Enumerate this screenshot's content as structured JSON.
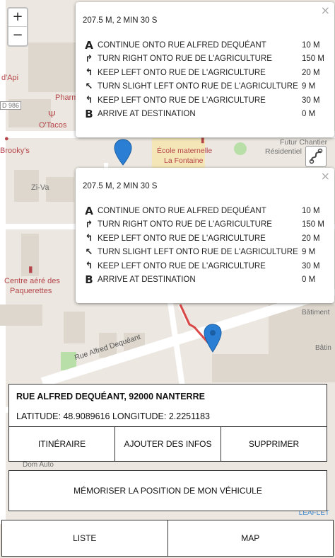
{
  "map": {
    "zoom_in": "+",
    "zoom_out": "−",
    "labels": {
      "dapi": "d'Api",
      "d986": "D 986",
      "pharm": "Pharm",
      "otacos": "O'Tacos",
      "brooky": "Brooky's",
      "ziva": "Zi-Va",
      "ecole1": "École maternelle",
      "ecole2": "La Fontaine",
      "futur1": "Futur Chantier",
      "futur2": "Résidentiel",
      "centre1": "Centre aéré des",
      "centre2": "Paquerettes",
      "batiment1": "Bâtiment",
      "batiment2": "Bâtin",
      "street": "Rue Alfred Dequéant",
      "dom_auto": "Dom Auto"
    },
    "attribution": "LEAFLET"
  },
  "route_panels": [
    {
      "summary": "207.5 M, 2 MIN 30 S",
      "close": "×",
      "instructions": [
        {
          "icon": "A",
          "text": "CONTINUE ONTO RUE ALFRED DEQUÉANT",
          "dist": "10 M"
        },
        {
          "icon": "↱",
          "text": "TURN RIGHT ONTO RUE DE L'AGRICULTURE",
          "dist": "150 M"
        },
        {
          "icon": "↰",
          "text": "KEEP LEFT ONTO RUE DE L'AGRICULTURE",
          "dist": "20 M"
        },
        {
          "icon": "↖",
          "text": "TURN SLIGHT LEFT ONTO RUE DE L'AGRICULTURE",
          "dist": "9 M"
        },
        {
          "icon": "↰",
          "text": "KEEP LEFT ONTO RUE DE L'AGRICULTURE",
          "dist": "30 M"
        },
        {
          "icon": "B",
          "text": "ARRIVE AT DESTINATION",
          "dist": "0 M"
        }
      ]
    },
    {
      "summary": "207.5 M, 2 MIN 30 S",
      "close": "×",
      "instructions": [
        {
          "icon": "A",
          "text": "CONTINUE ONTO RUE ALFRED DEQUÉANT",
          "dist": "10 M"
        },
        {
          "icon": "↱",
          "text": "TURN RIGHT ONTO RUE DE L'AGRICULTURE",
          "dist": "150 M"
        },
        {
          "icon": "↰",
          "text": "KEEP LEFT ONTO RUE DE L'AGRICULTURE",
          "dist": "20 M"
        },
        {
          "icon": "↖",
          "text": "TURN SLIGHT LEFT ONTO RUE DE L'AGRICULTURE",
          "dist": "9 M"
        },
        {
          "icon": "↰",
          "text": "KEEP LEFT ONTO RUE DE L'AGRICULTURE",
          "dist": "30 M"
        },
        {
          "icon": "B",
          "text": "ARRIVE AT DESTINATION",
          "dist": "0 M"
        }
      ]
    }
  ],
  "info": {
    "address": "RUE ALFRED DEQUÉANT, 92000 NANTERRE",
    "coords": "LATITUDE: 48.9089616 LONGITUDE: 2.2251183"
  },
  "actions": {
    "itinerary": "ITINÉRAIRE",
    "add_info": "AJOUTER DES INFOS",
    "delete": "SUPPRIMER",
    "save_vehicle": "MÉMORISER LA POSITION DE MON VÉHICULE"
  },
  "nav": {
    "list": "LISTE",
    "map": "MAP"
  },
  "colors": {
    "marker": "#2a7fd4",
    "route": "#d62a2a",
    "building": "#d9d3c9",
    "park": "#b9dfa9"
  }
}
